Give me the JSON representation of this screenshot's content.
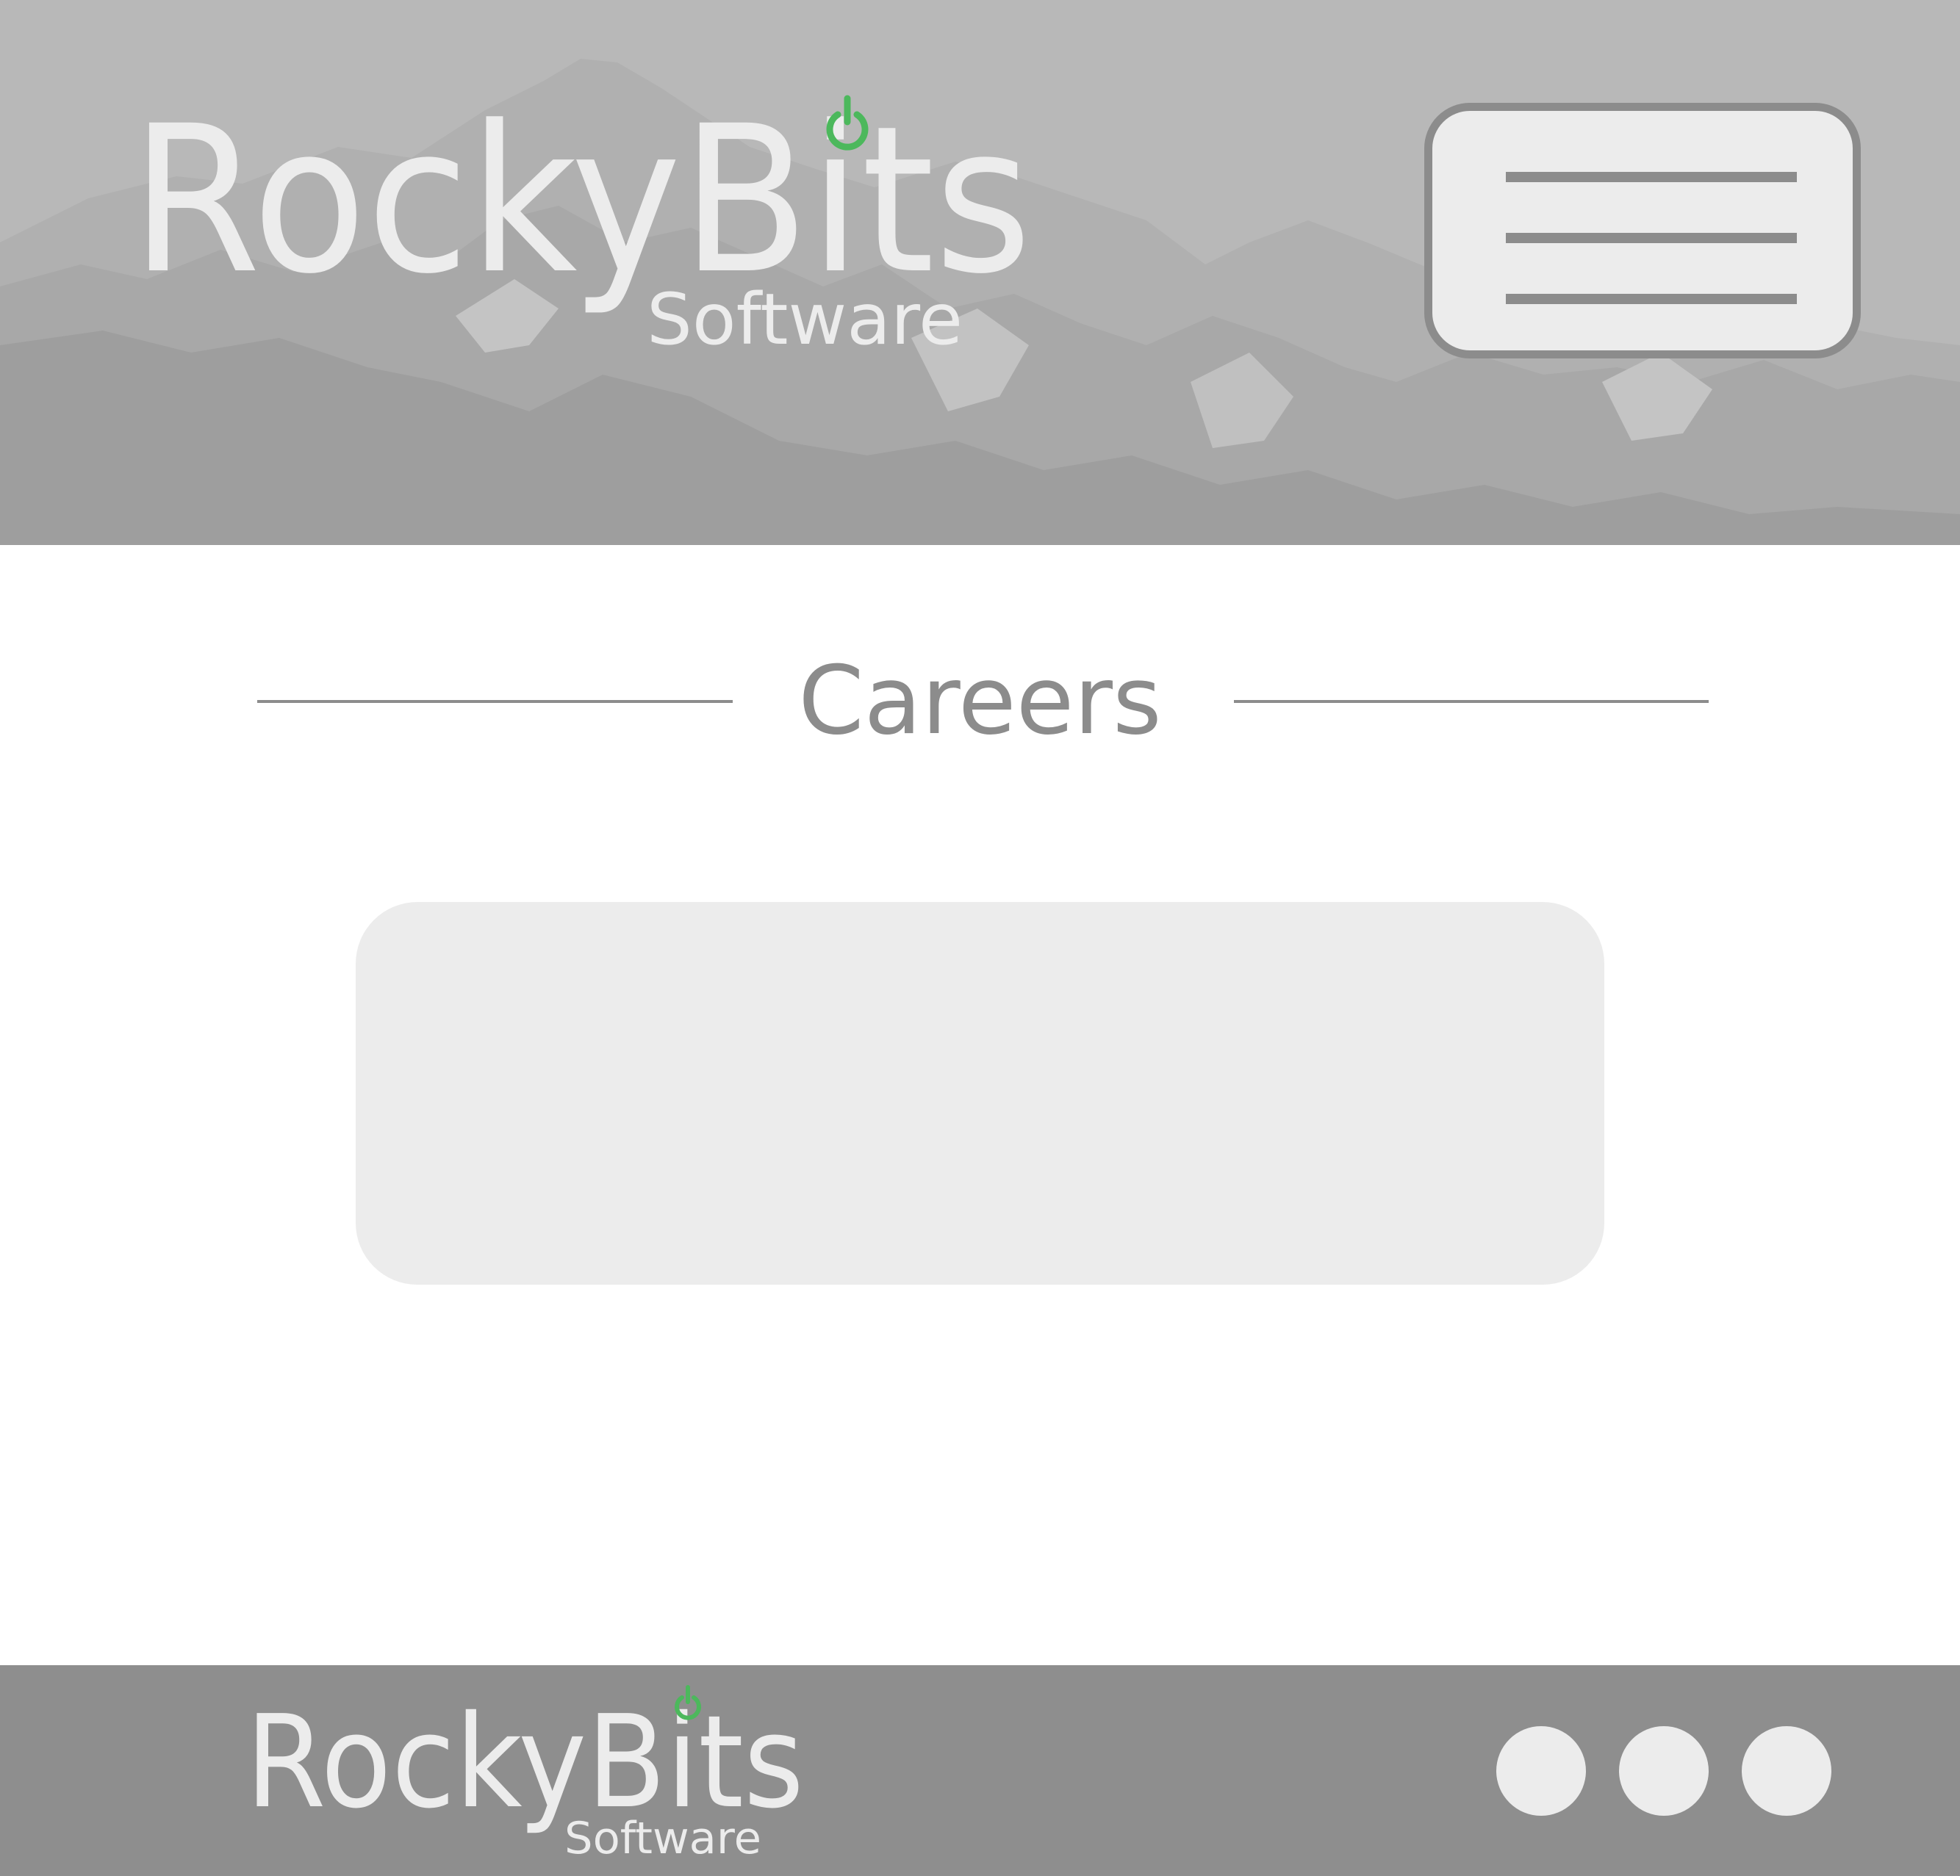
{
  "brand": {
    "name_part1": "Rocky",
    "name_part2": "Bits",
    "tagline": "Software",
    "accent_color": "#4cb85c",
    "logo_text_color": "#ececec",
    "power_icon": "power-icon"
  },
  "header": {
    "background": "mountain-landscape",
    "menu_icon": "hamburger-menu-icon"
  },
  "main": {
    "title": "Careers"
  },
  "footer": {
    "social_links": [
      {
        "icon": "social-circle-icon"
      },
      {
        "icon": "social-circle-icon"
      },
      {
        "icon": "social-circle-icon"
      }
    ]
  },
  "colors": {
    "header_bg": "#b8b8b8",
    "footer_bg": "#8e8e8e",
    "card_bg": "#ececec",
    "title_text": "#8c8c8c",
    "rule": "#8c8c8c"
  }
}
